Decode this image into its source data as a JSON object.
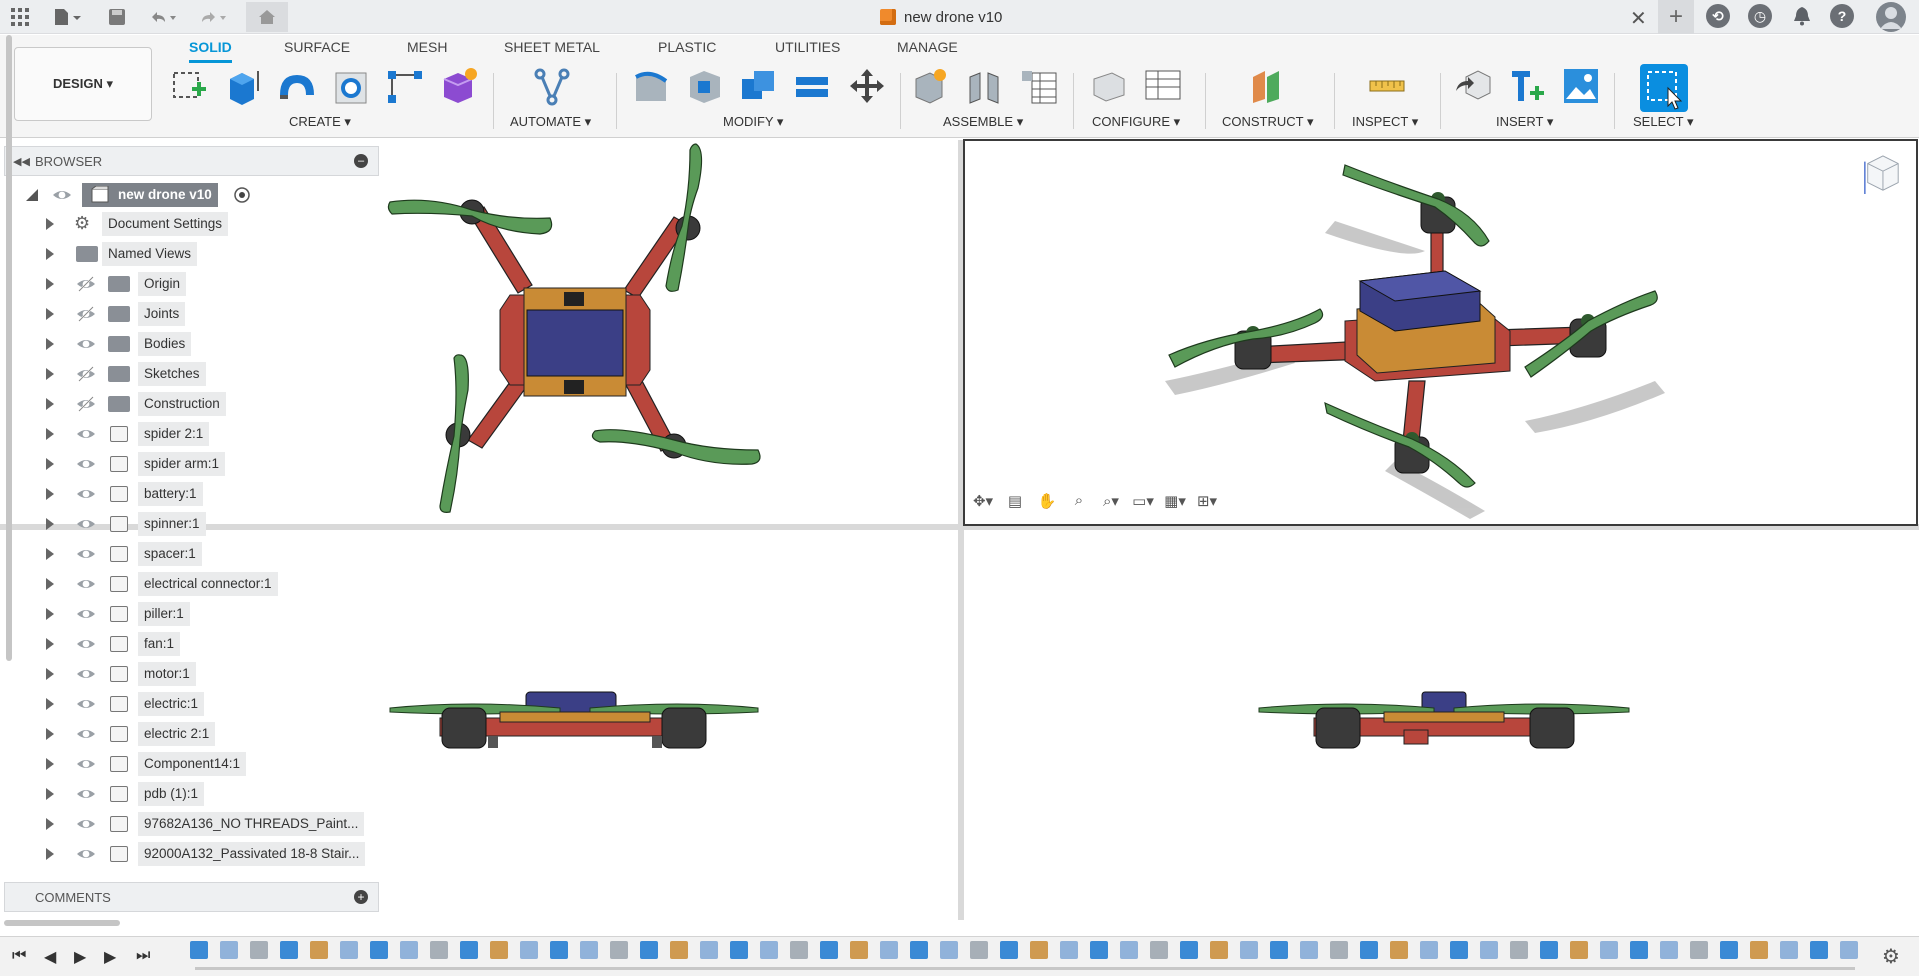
{
  "titlebar": {
    "document_title": "new drone v10",
    "icons": [
      "apps-grid-icon",
      "file-icon",
      "save-icon",
      "undo-icon",
      "redo-icon",
      "home-icon",
      "close-icon",
      "plus-icon",
      "extensions-icon",
      "job-status-icon",
      "notifications-icon",
      "help-icon",
      "user-avatar"
    ]
  },
  "toolbar": {
    "design_label": "DESIGN ▾",
    "tabs": [
      "SOLID",
      "SURFACE",
      "MESH",
      "SHEET METAL",
      "PLASTIC",
      "UTILITIES",
      "MANAGE"
    ],
    "active_tab": "SOLID",
    "groups": [
      "CREATE ▾",
      "AUTOMATE ▾",
      "MODIFY ▾",
      "ASSEMBLE ▾",
      "CONFIGURE ▾",
      "CONSTRUCT ▾",
      "INSPECT ▾",
      "INSERT ▾",
      "SELECT ▾"
    ]
  },
  "browser": {
    "title": "BROWSER",
    "root": "new drone v10",
    "items": [
      {
        "label": "Document Settings",
        "icon": "gear-icon",
        "eye": "none"
      },
      {
        "label": "Named Views",
        "icon": "folder-icon",
        "eye": "none"
      },
      {
        "label": "Origin",
        "icon": "folder-icon",
        "eye": "hidden"
      },
      {
        "label": "Joints",
        "icon": "folder-icon",
        "eye": "hidden"
      },
      {
        "label": "Bodies",
        "icon": "folder-icon",
        "eye": "visible"
      },
      {
        "label": "Sketches",
        "icon": "folder-icon",
        "eye": "hidden"
      },
      {
        "label": "Construction",
        "icon": "folder-icon",
        "eye": "hidden"
      },
      {
        "label": "spider 2:1",
        "icon": "component-icon",
        "eye": "visible"
      },
      {
        "label": "spider arm:1",
        "icon": "component-icon",
        "eye": "visible"
      },
      {
        "label": "battery:1",
        "icon": "component-icon",
        "eye": "visible"
      },
      {
        "label": "spinner:1",
        "icon": "component-icon",
        "eye": "visible"
      },
      {
        "label": "spacer:1",
        "icon": "component-icon",
        "eye": "visible"
      },
      {
        "label": "electrical connector:1",
        "icon": "component-icon",
        "eye": "visible"
      },
      {
        "label": "piller:1",
        "icon": "component-icon",
        "eye": "visible"
      },
      {
        "label": "fan:1",
        "icon": "component-icon",
        "eye": "visible"
      },
      {
        "label": "motor:1",
        "icon": "component-icon",
        "eye": "visible"
      },
      {
        "label": "electric:1",
        "icon": "component-icon",
        "eye": "visible"
      },
      {
        "label": "electric 2:1",
        "icon": "component-icon",
        "eye": "visible"
      },
      {
        "label": "Component14:1",
        "icon": "component-icon",
        "eye": "visible"
      },
      {
        "label": "pdb (1):1",
        "icon": "component-icon",
        "eye": "visible"
      },
      {
        "label": "97682A136_NO THREADS_Paint...",
        "icon": "component-icon",
        "eye": "visible"
      },
      {
        "label": "92000A132_Passivated 18-8 Stair...",
        "icon": "component-icon",
        "eye": "visible"
      }
    ]
  },
  "comments": {
    "title": "COMMENTS"
  },
  "colors": {
    "accent": "#0696d7",
    "frame": "#b8463c",
    "propeller": "#5a9a58",
    "battery": "#3b3f86",
    "plate": "#c98b35",
    "motor": "#3a3a3a"
  }
}
